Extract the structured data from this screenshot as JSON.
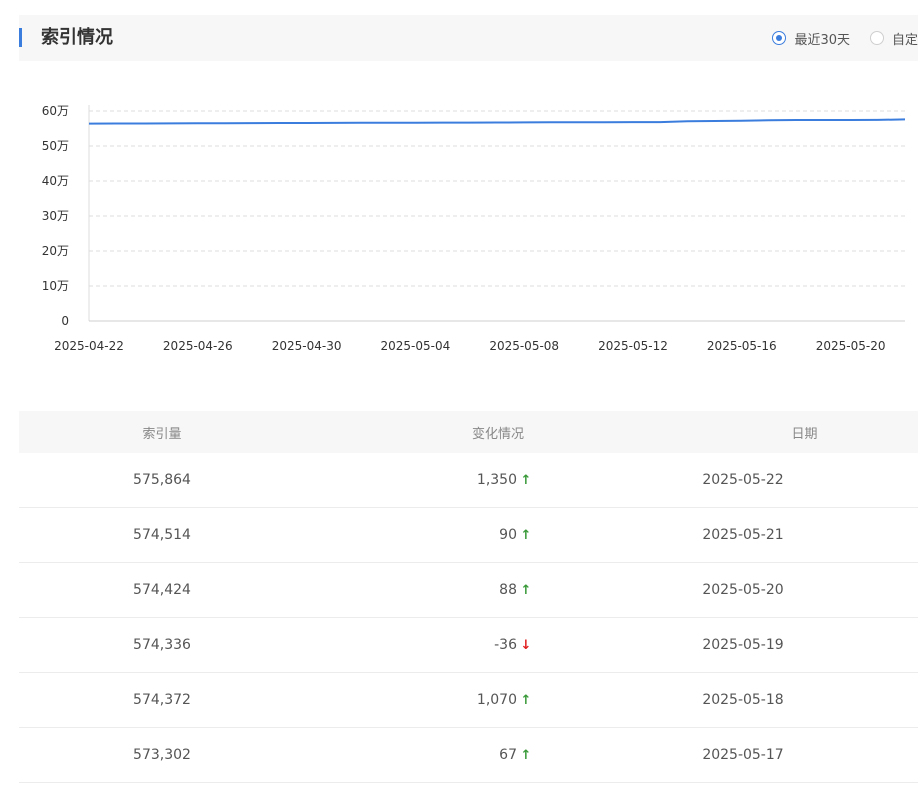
{
  "header": {
    "title": "索引情况",
    "options": [
      {
        "label": "最近30天",
        "selected": true
      },
      {
        "label": "自定",
        "selected": false
      }
    ]
  },
  "chart_data": {
    "type": "line",
    "title": "",
    "xlabel": "",
    "ylabel": "",
    "ylim": [
      0,
      600000
    ],
    "yticks": [
      0,
      100000,
      200000,
      300000,
      400000,
      500000,
      600000
    ],
    "ytick_labels": [
      "0",
      "10万",
      "20万",
      "30万",
      "40万",
      "50万",
      "60万"
    ],
    "xtick_labels": [
      "2025-04-22",
      "2025-04-26",
      "2025-04-30",
      "2025-05-04",
      "2025-05-08",
      "2025-05-12",
      "2025-05-16",
      "2025-05-20"
    ],
    "grid": true,
    "color": "#3b7ddd",
    "x": [
      "2025-04-22",
      "2025-04-23",
      "2025-04-24",
      "2025-04-25",
      "2025-04-26",
      "2025-04-27",
      "2025-04-28",
      "2025-04-29",
      "2025-04-30",
      "2025-05-01",
      "2025-05-02",
      "2025-05-03",
      "2025-05-04",
      "2025-05-05",
      "2025-05-06",
      "2025-05-07",
      "2025-05-08",
      "2025-05-09",
      "2025-05-10",
      "2025-05-11",
      "2025-05-12",
      "2025-05-13",
      "2025-05-14",
      "2025-05-15",
      "2025-05-16",
      "2025-05-17",
      "2025-05-18",
      "2025-05-19",
      "2025-05-20",
      "2025-05-21",
      "2025-05-22"
    ],
    "series": [
      {
        "values": [
          564000,
          564200,
          564400,
          564700,
          565000,
          565200,
          565400,
          565600,
          565800,
          566000,
          566200,
          566400,
          566600,
          566800,
          567000,
          567200,
          567400,
          567600,
          567800,
          568000,
          568200,
          568400,
          571000,
          571500,
          572000,
          573302,
          574372,
          574336,
          574424,
          574514,
          575864
        ]
      }
    ]
  },
  "table": {
    "headers": [
      "索引量",
      "变化情况",
      "日期"
    ],
    "rows": [
      {
        "count": "575,864",
        "change": "1,350",
        "dir": "up",
        "date": "2025-05-22"
      },
      {
        "count": "574,514",
        "change": "90",
        "dir": "up",
        "date": "2025-05-21"
      },
      {
        "count": "574,424",
        "change": "88",
        "dir": "up",
        "date": "2025-05-20"
      },
      {
        "count": "574,336",
        "change": "-36",
        "dir": "down",
        "date": "2025-05-19"
      },
      {
        "count": "574,372",
        "change": "1,070",
        "dir": "up",
        "date": "2025-05-18"
      },
      {
        "count": "573,302",
        "change": "67",
        "dir": "up",
        "date": "2025-05-17"
      }
    ]
  }
}
